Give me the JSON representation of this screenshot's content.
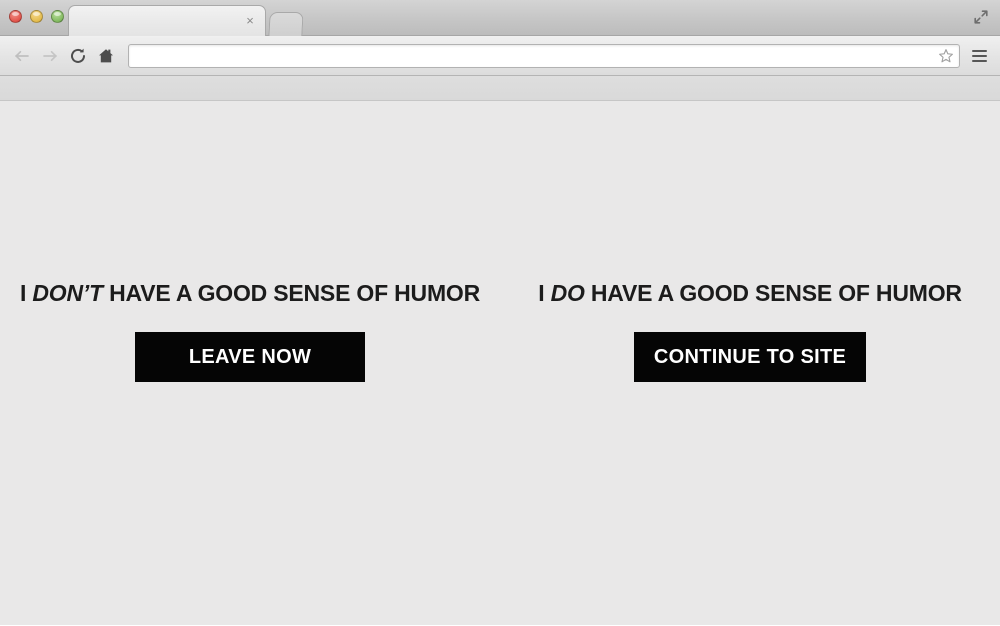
{
  "window": {
    "traffic_lights": [
      {
        "name": "close",
        "color": "#e2544b"
      },
      {
        "name": "minimize",
        "color": "#e4bc4d"
      },
      {
        "name": "zoom",
        "color": "#83bb61"
      }
    ],
    "fullscreen_icon": "fullscreen-expand-icon"
  },
  "tabs": [
    {
      "title": "",
      "close_label": "×",
      "active": true
    }
  ],
  "new_tab_button": {
    "icon": "new-tab-icon",
    "label": ""
  },
  "toolbar": {
    "back": {
      "icon": "back-arrow-icon",
      "enabled": false
    },
    "forward": {
      "icon": "forward-arrow-icon",
      "enabled": false
    },
    "reload": {
      "icon": "reload-icon",
      "enabled": true
    },
    "home": {
      "icon": "home-icon",
      "enabled": true
    },
    "omnibox": {
      "value": "",
      "placeholder": "",
      "bookmark_icon": "star-outline-icon"
    },
    "menu": {
      "icon": "hamburger-menu-icon"
    }
  },
  "page": {
    "background_color": "#e9e8e8",
    "text_color": "#1c1c1c",
    "button_background": "#050505",
    "button_text_color": "#ffffff",
    "choices": [
      {
        "heading_prefix": "I ",
        "heading_emphasis": "DON’T",
        "heading_suffix": " HAVE A GOOD SENSE OF HUMOR",
        "button_label": "LEAVE NOW"
      },
      {
        "heading_prefix": "I ",
        "heading_emphasis": "DO",
        "heading_suffix": " HAVE A GOOD SENSE OF HUMOR",
        "button_label": "CONTINUE TO SITE"
      }
    ]
  }
}
